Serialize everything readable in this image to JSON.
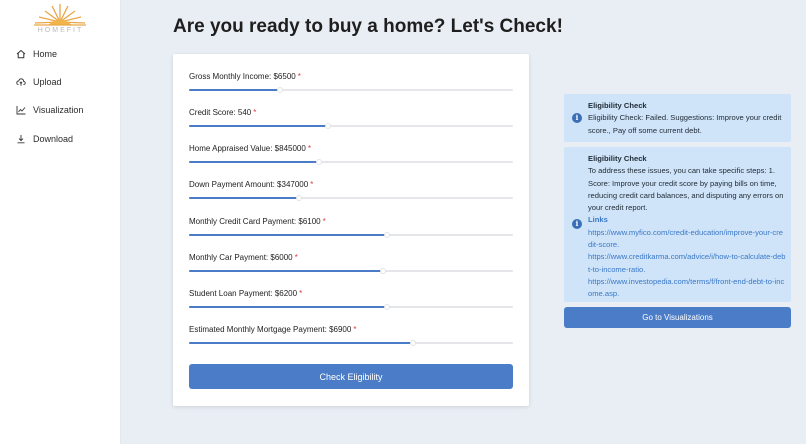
{
  "brand": {
    "logo_text": "HOMEFIT"
  },
  "sidebar": {
    "items": [
      {
        "label": "Home",
        "icon": "home-icon"
      },
      {
        "label": "Upload",
        "icon": "upload-icon"
      },
      {
        "label": "Visualization",
        "icon": "line-chart-icon"
      },
      {
        "label": "Download",
        "icon": "download-icon"
      }
    ]
  },
  "page": {
    "title": "Are you ready to buy a home? Let's Check!"
  },
  "form": {
    "required_marker": "*",
    "fields": [
      {
        "label": "Gross Monthly Income: $6500",
        "fill_fraction": 0.28
      },
      {
        "label": "Credit Score: 540",
        "fill_fraction": 0.43
      },
      {
        "label": "Home Appraised Value: $845000",
        "fill_fraction": 0.4
      },
      {
        "label": "Down Payment Amount: $347000",
        "fill_fraction": 0.34
      },
      {
        "label": "Monthly Credit Card Payment: $6100",
        "fill_fraction": 0.61
      },
      {
        "label": "Monthly Car Payment: $6000",
        "fill_fraction": 0.6
      },
      {
        "label": "Student Loan Payment: $6200",
        "fill_fraction": 0.61
      },
      {
        "label": "Estimated Monthly Mortgage Payment: $6900",
        "fill_fraction": 0.69
      }
    ],
    "submit_label": "Check Eligibility"
  },
  "eligibility": {
    "summary": {
      "title": "Eligibility Check",
      "text": "Eligibility Check: Failed. Suggestions: Improve your credit score., Pay off some current debt."
    },
    "details": {
      "title": "Eligibility Check",
      "text": "To address these issues, you can take specific steps: 1. Score: Improve your credit score by paying bills on time, reducing credit card balances, and disputing any errors on your credit report.",
      "links_title": "Links",
      "links": [
        "https://www.myfico.com/credit-education/improve-your-credit-score.",
        "https://www.creditkarma.com/advice/i/how-to-calculate-debt-to-income-ratio.",
        "https://www.investopedia.com/terms/f/front-end-debt-to-income.asp."
      ]
    },
    "viz_button_label": "Go to Visualizations"
  },
  "colors": {
    "accent": "#4a7cc7",
    "info_bg": "#cfe4f8",
    "required": "#d93a3a"
  }
}
